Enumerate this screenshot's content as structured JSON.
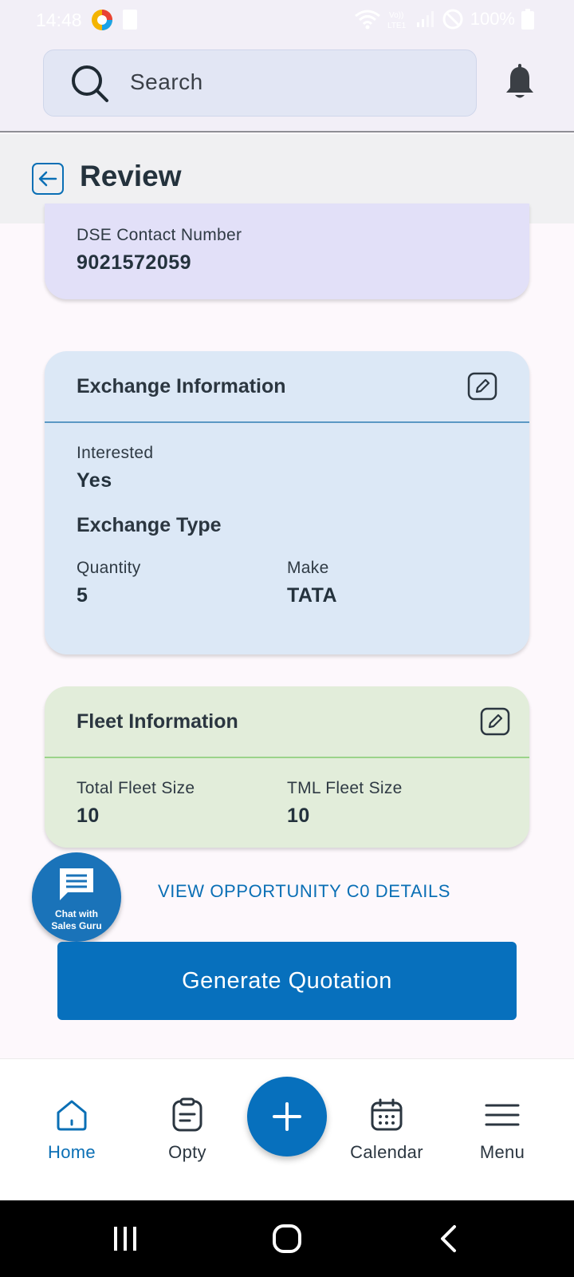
{
  "status_bar": {
    "time": "14:48",
    "battery": "100%",
    "icons": [
      "app-notification-icon",
      "sd-card-icon",
      "wifi-icon",
      "volte-icon",
      "signal-icon",
      "do-not-disturb-icon",
      "battery-icon"
    ]
  },
  "search": {
    "placeholder": "Search"
  },
  "header": {
    "title": "Review"
  },
  "dse": {
    "label": "DSE Contact Number",
    "value": "9021572059"
  },
  "exchange": {
    "title": "Exchange Information",
    "interested_label": "Interested",
    "interested_value": "Yes",
    "type_heading": "Exchange Type",
    "quantity_label": "Quantity",
    "quantity_value": "5",
    "make_label": "Make",
    "make_value": "TATA"
  },
  "fleet": {
    "title": "Fleet Information",
    "total_label": "Total Fleet Size",
    "total_value": "10",
    "tml_label": "TML Fleet Size",
    "tml_value": "10"
  },
  "chat_fab": {
    "line1": "Chat with",
    "line2": "Sales Guru"
  },
  "view_link": "VIEW OPPORTUNITY C0 DETAILS",
  "generate_button": "Generate Quotation",
  "bottom_nav": {
    "items": [
      {
        "label": "Home",
        "icon": "home-icon",
        "active": true
      },
      {
        "label": "Opty",
        "icon": "clipboard-icon",
        "active": false
      },
      {
        "label": "Calendar",
        "icon": "calendar-icon",
        "active": false
      },
      {
        "label": "Menu",
        "icon": "hamburger-menu-icon",
        "active": false
      }
    ]
  },
  "colors": {
    "primary": "#0770bd",
    "dse_card": "#e2e0f8",
    "exchange_card": "#dce8f6",
    "fleet_card": "#e2edda"
  }
}
